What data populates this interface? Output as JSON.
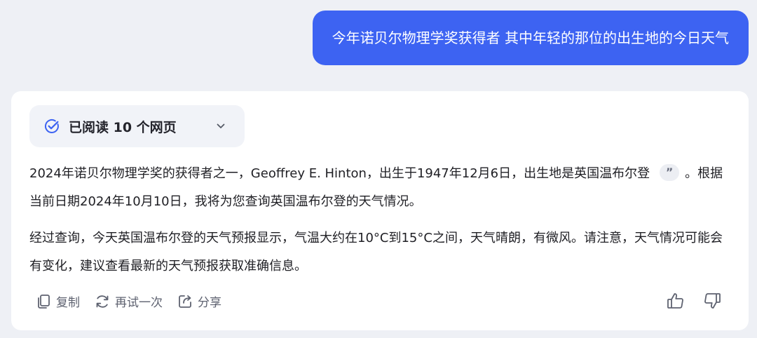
{
  "user_message": "今年诺贝尔物理学奖获得者 其中年轻的那位的出生地的今日天气",
  "read_chip": {
    "label": "已阅读 10 个网页",
    "icon": "check-circle-icon",
    "expand_icon": "chevron-down-icon"
  },
  "answer": {
    "p1_before_cite": "2024年诺贝尔物理学奖的获得者之一，Geoffrey E. Hinton，出生于1947年12月6日，出生地是英国温布尔登",
    "cite_label": "”",
    "p1_after_cite": "。根据当前日期2024年10月10日，我将为您查询英国温布尔登的天气情况。",
    "p2": "经过查询，今天英国温布尔登的天气预报显示，气温大约在10°C到15°C之间，天气晴朗，有微风。请注意，天气情况可能会有变化，建议查看最新的天气预报获取准确信息。"
  },
  "actions": {
    "copy": "复制",
    "retry": "再试一次",
    "share": "分享"
  },
  "colors": {
    "accent": "#3d63f2",
    "background": "#eef0f5",
    "card": "#ffffff",
    "chip": "#f1f3f8"
  }
}
